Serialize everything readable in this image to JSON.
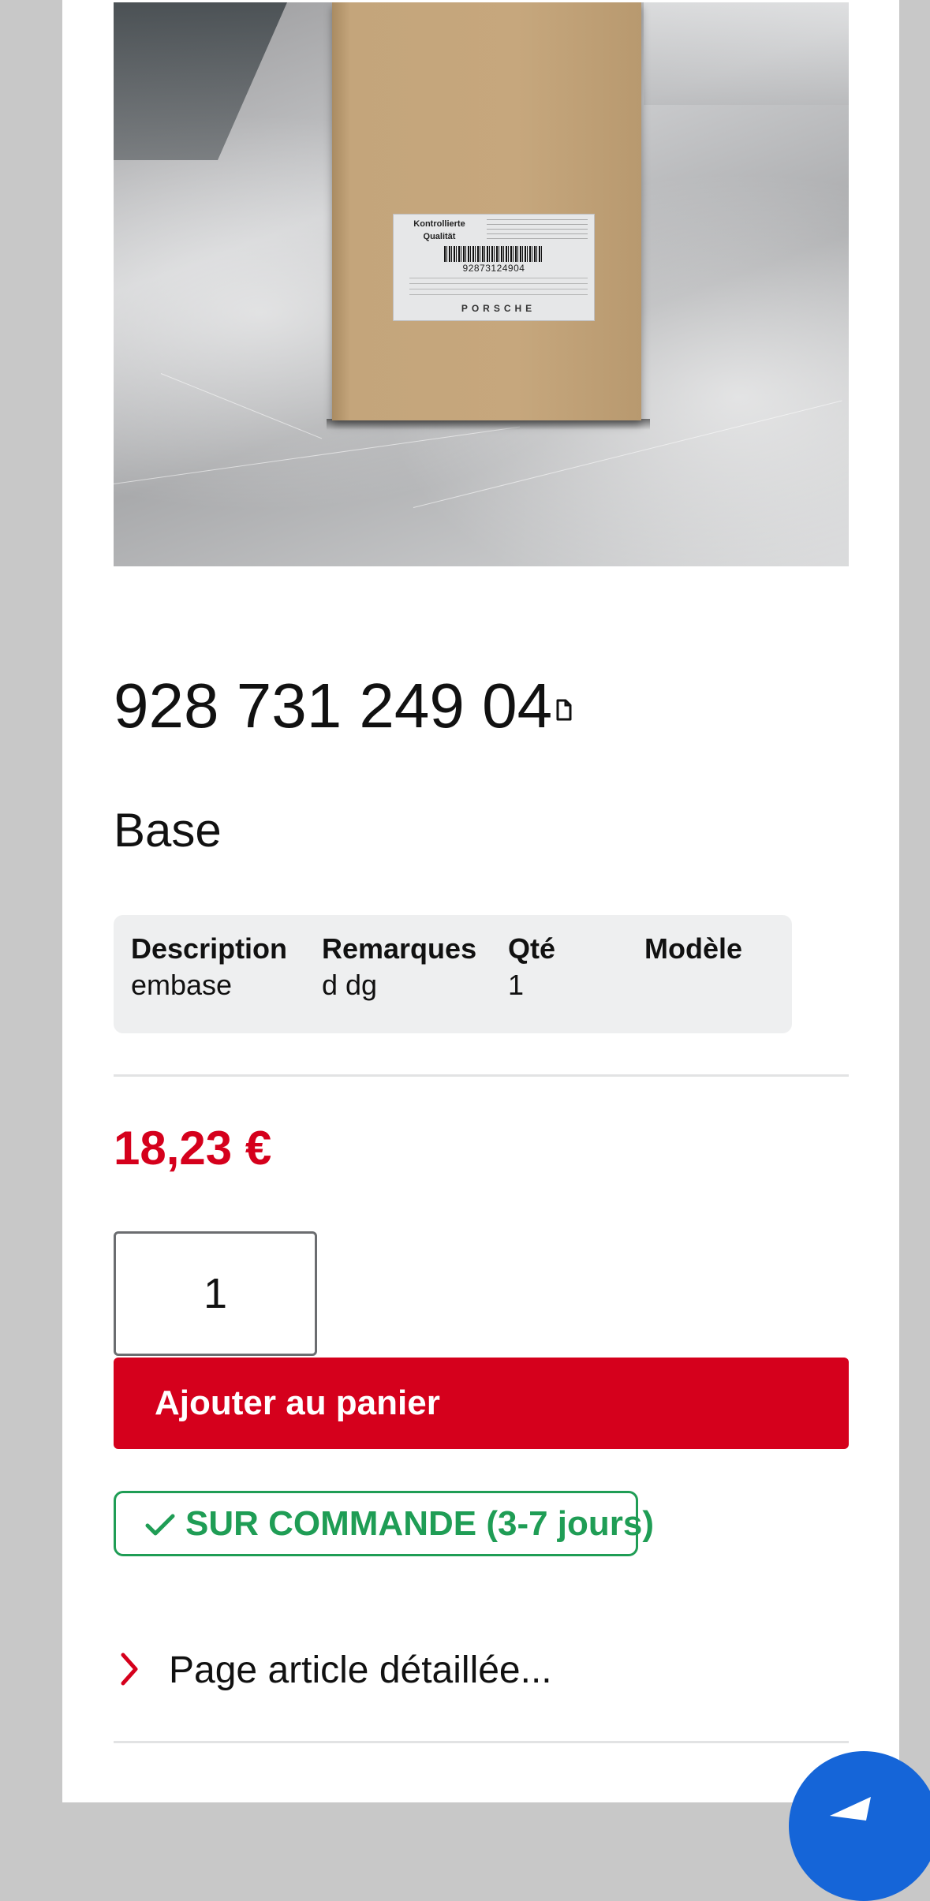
{
  "product_image": {
    "label_title": "Kontrollierte Qualität",
    "barcode_number": "92873124904",
    "brand": "PORSCHE"
  },
  "product": {
    "part_number": "928 731 249 04",
    "name": "Base"
  },
  "info_table": {
    "headers": [
      "Description",
      "Remarques",
      "Qté",
      "Modèle"
    ],
    "values": [
      "embase",
      "d dg",
      "1",
      ""
    ]
  },
  "price": "18,23 €",
  "quantity": "1",
  "add_to_cart_label": "Ajouter au panier",
  "stock_status": "SUR COMMANDE (3-7 jours)",
  "detail_link_label": "Page article détaillée...",
  "colors": {
    "accent_red": "#d5001c",
    "stock_green": "#1f9d55",
    "fab_blue": "#1565d8"
  },
  "icons": {
    "document": "document-icon",
    "check": "check-icon",
    "chevron": "chevron-right-icon",
    "fab": "chat-icon"
  }
}
